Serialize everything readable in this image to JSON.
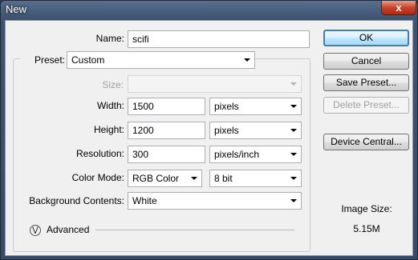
{
  "window": {
    "title": "New",
    "close_glyph": "x"
  },
  "name": {
    "label": "Name:",
    "value": "scifi"
  },
  "preset": {
    "label": "Preset:",
    "value": "Custom"
  },
  "size": {
    "label": "Size:",
    "value": ""
  },
  "width": {
    "label": "Width:",
    "value": "1500",
    "unit": "pixels"
  },
  "height": {
    "label": "Height:",
    "value": "1200",
    "unit": "pixels"
  },
  "resolution": {
    "label": "Resolution:",
    "value": "300",
    "unit": "pixels/inch"
  },
  "color_mode": {
    "label": "Color Mode:",
    "value": "RGB Color",
    "depth": "8 bit"
  },
  "background": {
    "label": "Background Contents:",
    "value": "White"
  },
  "advanced": {
    "label": "Advanced",
    "icon": "chevron-double-down-icon"
  },
  "buttons": {
    "ok": "OK",
    "cancel": "Cancel",
    "save_preset": "Save Preset...",
    "delete_preset": "Delete Preset...",
    "device_central": "Device Central..."
  },
  "image_size": {
    "label": "Image Size:",
    "value": "5.15M"
  }
}
